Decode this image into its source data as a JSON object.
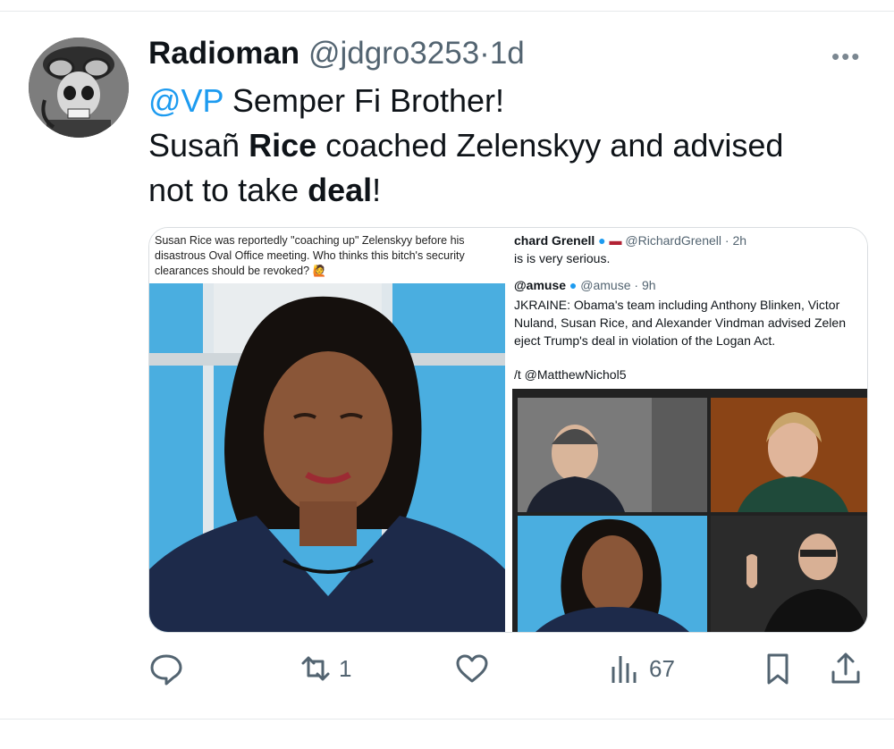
{
  "tweet": {
    "display_name": "Radioman",
    "handle": "@jdgro3253",
    "separator": "·",
    "time": "1d",
    "mention": "@VP",
    "line1_rest": " Semper Fi Brother!",
    "line2_a": "Susañ ",
    "line2_b": "Rice",
    "line2_c": " coached Zelenskyy and advised",
    "line3_a": "not to take ",
    "line3_b": "deal",
    "line3_c": "!"
  },
  "media": {
    "left_caption": "Susan Rice was reportedly \"coaching up\" Zelenskyy before his disastrous Oval Office meeting. Who thinks this bitch's security clearances should be revoked? 🙋",
    "quote_name": "chard Grenell",
    "quote_handle": "@RichardGrenell",
    "quote_time": "· 2h",
    "quote_text": "is is very serious.",
    "inner_name": "@amuse",
    "inner_handle": "@amuse",
    "inner_time": "· 9h",
    "inner_line1": "JKRAINE: Obama's team including Anthony Blinken, Victor",
    "inner_line2": "Nuland, Susan Rice, and Alexander Vindman advised Zelen",
    "inner_line3": "eject Trump's deal in violation of the Logan Act.",
    "inner_hattip": "/t @MatthewNichol5"
  },
  "actions": {
    "reply_count": "",
    "retweet_count": "1",
    "like_count": "",
    "views_count": "67"
  },
  "colors": {
    "accent": "#1d9bf0",
    "muted": "#536471",
    "text": "#0f1419"
  }
}
